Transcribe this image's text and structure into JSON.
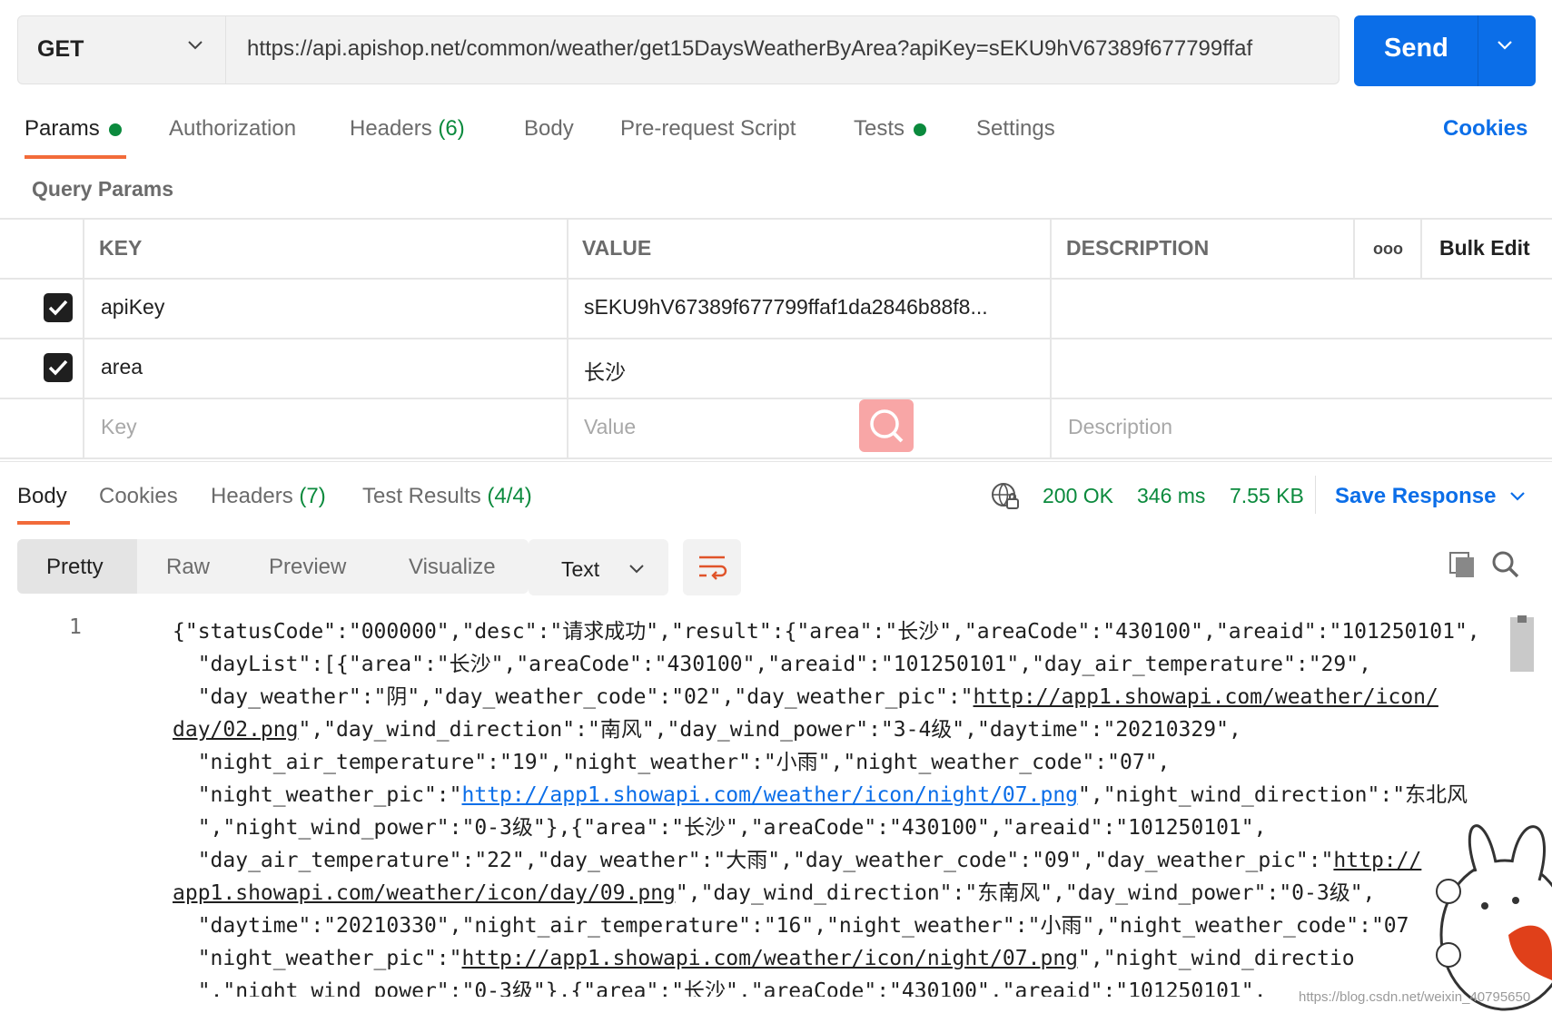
{
  "request": {
    "method": "GET",
    "url": "https://api.apishop.net/common/weather/get15DaysWeatherByArea?apiKey=sEKU9hV67389f677799ffaf",
    "send_label": "Send"
  },
  "request_tabs": {
    "params": "Params",
    "authorization": "Authorization",
    "headers": "Headers",
    "headers_count": "(6)",
    "body": "Body",
    "prerequest": "Pre-request Script",
    "tests": "Tests",
    "settings": "Settings",
    "cookies": "Cookies"
  },
  "query_params": {
    "title": "Query Params",
    "columns": {
      "key": "KEY",
      "value": "VALUE",
      "description": "DESCRIPTION",
      "more": "ooo",
      "bulk_edit": "Bulk Edit"
    },
    "rows": [
      {
        "key": "apiKey",
        "value": "sEKU9hV67389f677799ffaf1da2846b88f8...",
        "checked": true
      },
      {
        "key": "area",
        "value": "长沙",
        "checked": true
      }
    ],
    "placeholders": {
      "key": "Key",
      "value": "Value",
      "description": "Description"
    }
  },
  "response": {
    "tabs": {
      "body": "Body",
      "cookies": "Cookies",
      "headers": "Headers",
      "headers_count": "(7)",
      "test_results": "Test Results",
      "test_results_count": "(4/4)"
    },
    "status": "200 OK",
    "time": "346 ms",
    "size": "7.55 KB",
    "save_response": "Save Response",
    "views": {
      "pretty": "Pretty",
      "raw": "Raw",
      "preview": "Preview",
      "visualize": "Visualize"
    },
    "format": "Text",
    "line_number": "1",
    "lines": [
      "{\"statusCode\":\"000000\",\"desc\":\"请求成功\",\"result\":{\"area\":\"长沙\",\"areaCode\":\"430100\",\"areaid\":\"101250101\",",
      "  \"dayList\":[{\"area\":\"长沙\",\"areaCode\":\"430100\",\"areaid\":\"101250101\",\"day_air_temperature\":\"29\",",
      "  \"day_weather\":\"阴\",\"day_weather_code\":\"02\",\"day_weather_pic\":\"",
      "http://app1.showapi.com/weather/icon/",
      "day/02.png",
      "\",\"day_wind_direction\":\"南风\",\"day_wind_power\":\"3-4级\",\"daytime\":\"20210329\",",
      "  \"night_air_temperature\":\"19\",\"night_weather\":\"小雨\",\"night_weather_code\":\"07\",",
      "  \"night_weather_pic\":\"",
      "http://app1.showapi.com/weather/icon/night/07.png",
      "\",\"night_wind_direction\":\"东北风",
      "  \",\"night_wind_power\":\"0-3级\"},{\"area\":\"长沙\",\"areaCode\":\"430100\",\"areaid\":\"101250101\",",
      "  \"day_air_temperature\":\"22\",\"day_weather\":\"大雨\",\"day_weather_code\":\"09\",\"day_weather_pic\":\"",
      "http://",
      "app1.showapi.com/weather/icon/day/09.png",
      "\",\"day_wind_direction\":\"东南风\",\"day_wind_power\":\"0-3级\",",
      "  \"daytime\":\"20210330\",\"night_air_temperature\":\"16\",\"night_weather\":\"小雨\",\"night_weather_code\":\"07",
      "  \"night_weather_pic\":\"",
      "http://app1.showapi.com/weather/icon/night/07.png",
      "\",\"night_wind_directio",
      "  \",\"night_wind_power\":\"0-3级\"},{\"area\":\"长沙\",\"areaCode\":\"430100\",\"areaid\":\"101250101\","
    ]
  },
  "watermark": "https://blog.csdn.net/weixin_40795650",
  "colors": {
    "accent": "#0b6ee8",
    "tab_underline": "#f26b3a",
    "success": "#0b8a3d"
  },
  "icons": [
    "chevron-down-icon",
    "globe-lock-icon",
    "copy-icon",
    "search-icon",
    "wrap-lines-icon",
    "checkbox-checked-icon"
  ]
}
